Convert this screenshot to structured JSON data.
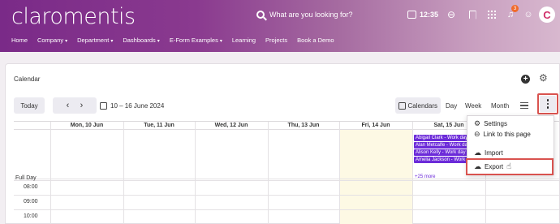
{
  "app": {
    "logo": "claromentis"
  },
  "header": {
    "search_placeholder": "What are you looking for?",
    "time": "12:35",
    "notification_count": "3",
    "brand_icon_label": "C"
  },
  "nav": {
    "items": [
      {
        "label": "Home",
        "dropdown": false
      },
      {
        "label": "Company",
        "dropdown": true
      },
      {
        "label": "Department",
        "dropdown": true
      },
      {
        "label": "Dashboards",
        "dropdown": true
      },
      {
        "label": "E-Form Examples",
        "dropdown": true
      },
      {
        "label": "Learning",
        "dropdown": false
      },
      {
        "label": "Projects",
        "dropdown": false
      },
      {
        "label": "Book a Demo",
        "dropdown": false
      }
    ]
  },
  "calendar": {
    "title": "Calendar",
    "toolbar": {
      "today": "Today",
      "prev": "‹",
      "next": "›",
      "range": "10 – 16 June 2024",
      "calendars": "Calendars",
      "views": [
        "Day",
        "Week",
        "Month"
      ]
    },
    "columns": [
      "Mon, 10 Jun",
      "Tue, 11 Jun",
      "Wed, 12 Jun",
      "Thu, 13 Jun",
      "Fri, 14 Jun",
      "Sat, 15 Jun"
    ],
    "full_day_label": "Full Day",
    "times": [
      "08:00",
      "09:00",
      "10:00"
    ],
    "events": [
      "Abigail Clark - Work day",
      "Alan Metcalfe - Work day",
      "Alison Kelly - Work day",
      "Amelia Jackson - Work day"
    ],
    "more": "+25 more"
  },
  "menu": {
    "items": [
      {
        "label": "Settings",
        "icon": "gear-icon"
      },
      {
        "label": "Link to this page",
        "icon": "link-icon"
      },
      {
        "label": "Import",
        "icon": "cloud-upload-icon"
      },
      {
        "label": "Export",
        "icon": "cloud-download-icon"
      }
    ]
  },
  "colors": {
    "accent": "#7a2a88",
    "event": "#6c2bd9",
    "highlight": "#d9534f",
    "today_column": "#fdf9e4"
  }
}
